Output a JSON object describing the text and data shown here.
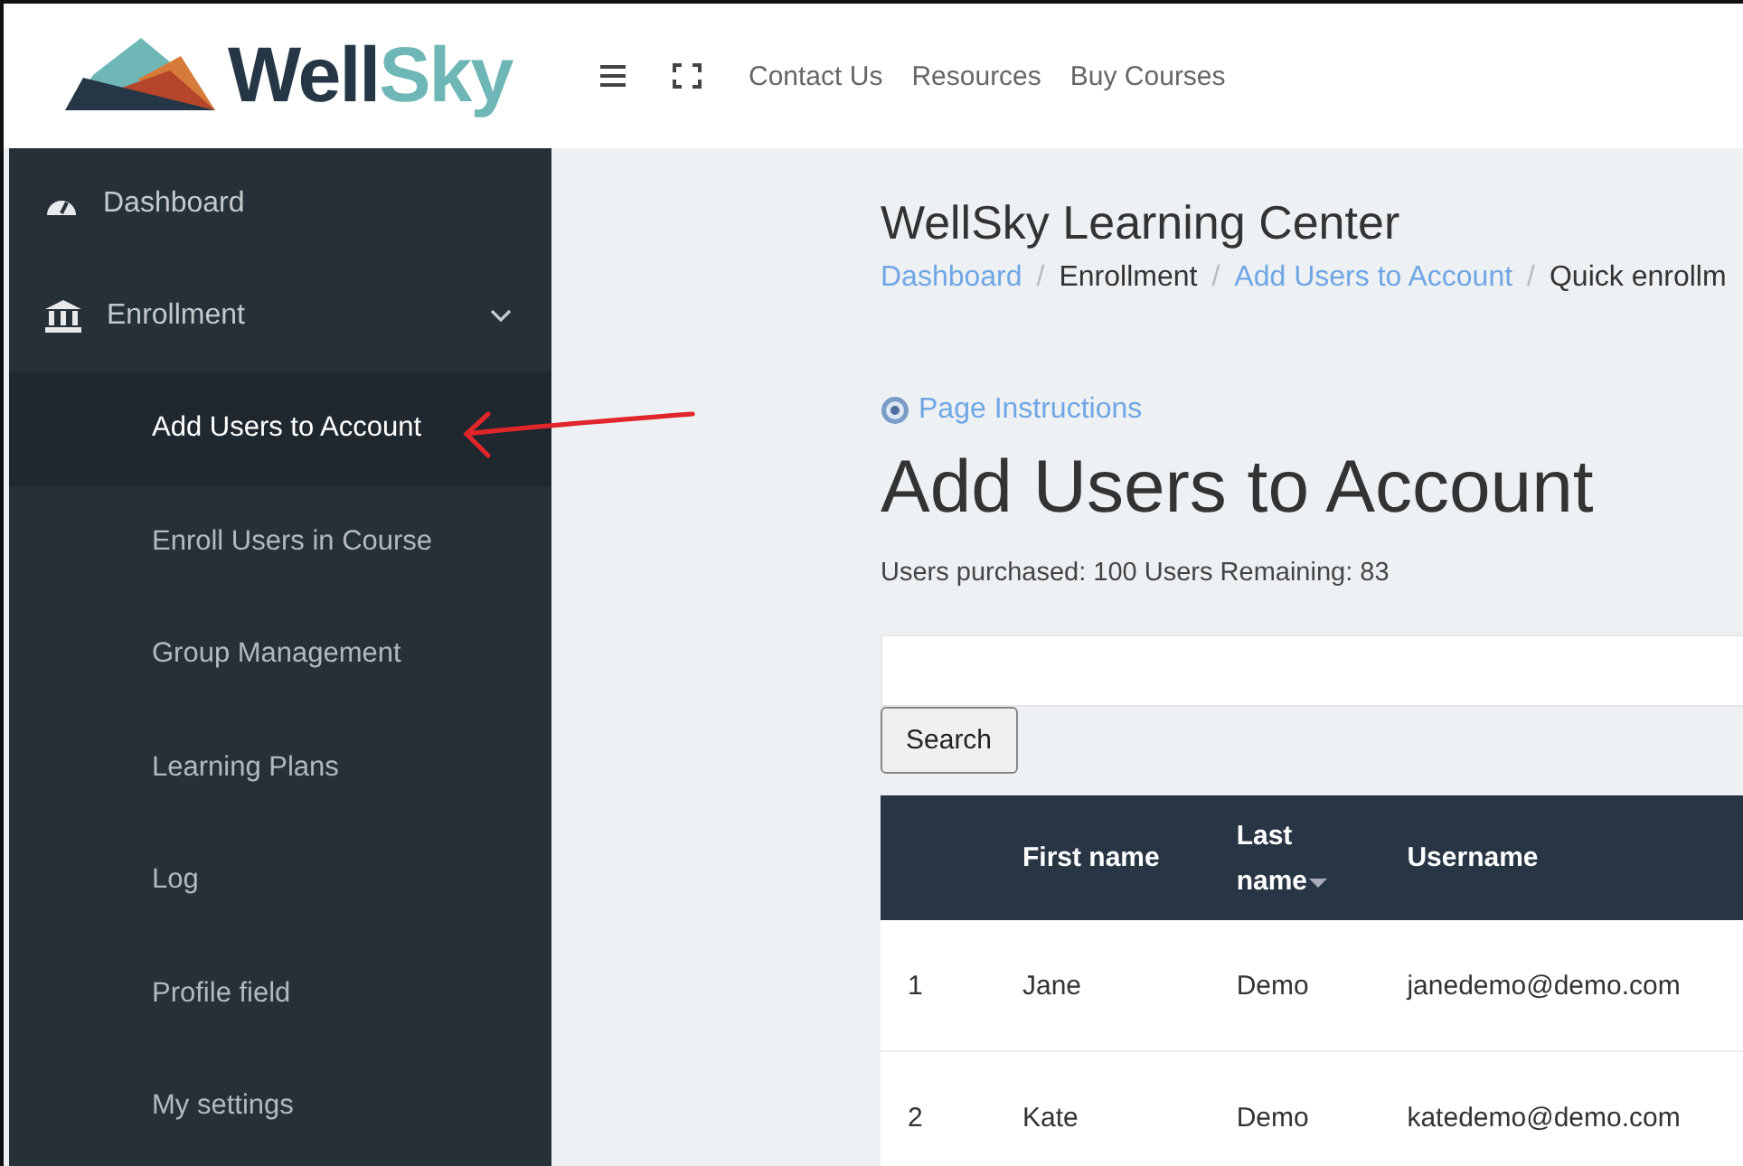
{
  "logo": {
    "parts": [
      "Well",
      "Sky"
    ]
  },
  "topnav": {
    "links": [
      "Contact Us",
      "Resources",
      "Buy Courses"
    ]
  },
  "sidebar": {
    "items": [
      {
        "label": "Dashboard",
        "selected": false
      },
      {
        "label": "Enrollment",
        "expanded": true,
        "selected": false,
        "children": [
          {
            "label": "Add Users to Account",
            "selected": true
          },
          {
            "label": "Enroll Users in Course",
            "selected": false
          },
          {
            "label": "Group Management",
            "selected": false
          },
          {
            "label": "Learning Plans",
            "selected": false
          },
          {
            "label": "Log",
            "selected": false
          },
          {
            "label": "Profile field",
            "selected": false
          },
          {
            "label": "My settings",
            "selected": false
          }
        ]
      }
    ]
  },
  "site_title": "WellSky Learning Center",
  "breadcrumb": [
    {
      "label": "Dashboard",
      "link": true
    },
    {
      "separator": "/",
      "label": "Enrollment",
      "link": false
    },
    {
      "separator": "/",
      "label": "Add Users to Account",
      "link": true
    },
    {
      "separator": "/",
      "label": "Quick enrollm",
      "link": false
    }
  ],
  "instructions_link": "Page Instructions",
  "heading": "Add Users to Account",
  "summary": "Users purchased: 100 Users Remaining: 83",
  "search_button": "Search",
  "table": {
    "columns": [
      {},
      {
        "label": "First name"
      },
      {
        "label": "Last name",
        "sorted": true
      },
      {
        "label": "Username"
      }
    ],
    "rows": [
      [
        "1",
        "Jane",
        "Demo",
        "janedemo@demo.com"
      ],
      [
        "2",
        "Kate",
        "Demo",
        "katedemo@demo.com"
      ]
    ]
  },
  "annotation": {
    "kind": "arrow"
  }
}
